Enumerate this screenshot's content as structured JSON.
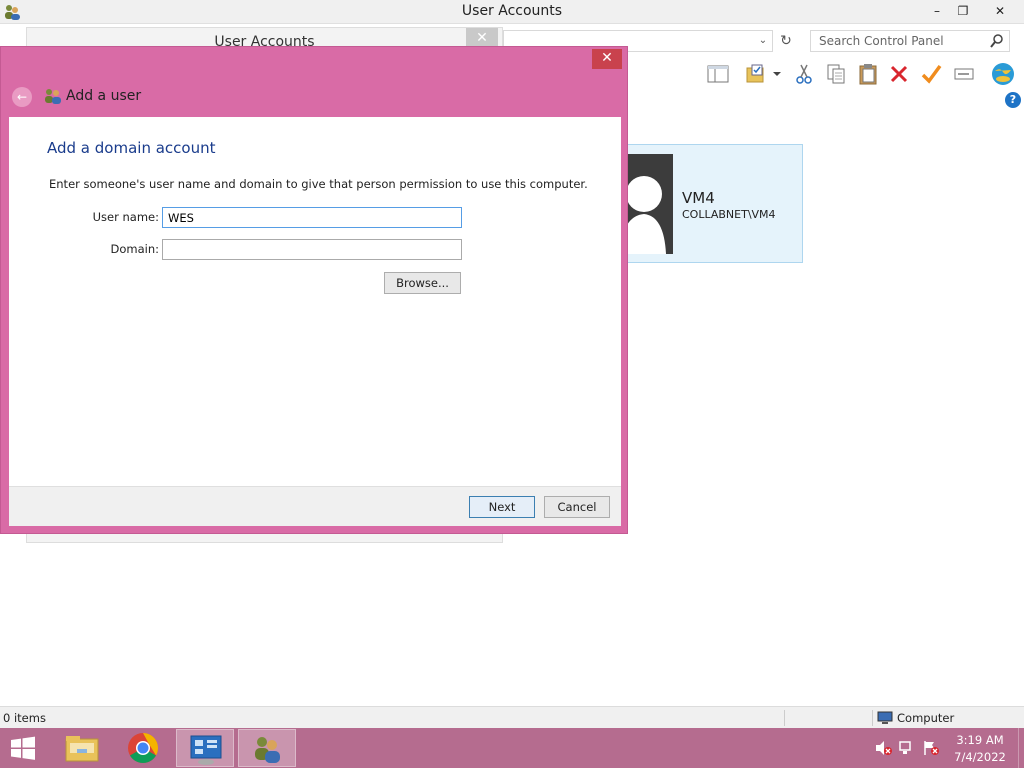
{
  "main_window": {
    "title": "User Accounts",
    "controls": {
      "minimize": "–",
      "maximize": "❐",
      "close": "✕"
    },
    "address_dropdown_glyph": "⌄",
    "refresh_glyph": "↻",
    "search": {
      "placeholder": "Search Control Panel",
      "value": ""
    },
    "help_glyph": "?"
  },
  "background_window": {
    "title": "User Accounts",
    "close_glyph": "✕"
  },
  "user_card": {
    "name": "VM4",
    "domain_account": "COLLABNET\\VM4"
  },
  "dialog": {
    "close_glyph": "✕",
    "back_glyph": "←",
    "title": "Add a user",
    "heading": "Add a domain account",
    "description": "Enter someone's user name and domain to give that person permission to use this computer.",
    "username_label": "User name:",
    "username_value": "WES",
    "domain_label": "Domain:",
    "domain_value": "",
    "browse_label": "Browse...",
    "next_label": "Next",
    "cancel_label": "Cancel",
    "accent_color": "#d96ba6"
  },
  "status_bar": {
    "items_count": "0 items",
    "location": "Computer"
  },
  "taskbar": {
    "color": "#b56c8f",
    "pinned": [
      "file-explorer-icon",
      "chrome-icon",
      "server-manager-icon",
      "user-accounts-icon"
    ],
    "clock_time": "3:19 AM",
    "clock_date": "7/4/2022"
  }
}
